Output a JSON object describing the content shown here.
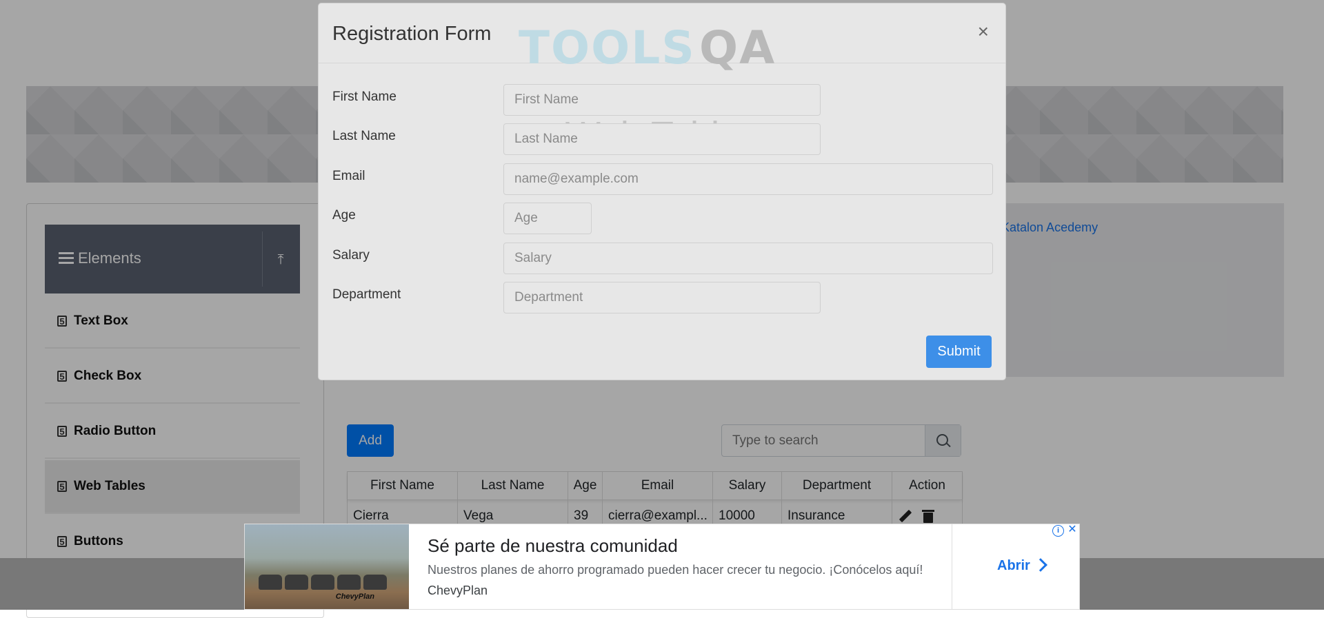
{
  "page": {
    "banner_title": "Web Tables"
  },
  "sidebar": {
    "group_title": "Elements",
    "items": [
      {
        "label": "Text Box"
      },
      {
        "label": "Check Box"
      },
      {
        "label": "Radio Button"
      },
      {
        "label": "Web Tables"
      },
      {
        "label": "Buttons"
      }
    ]
  },
  "toolbar": {
    "add_label": "Add",
    "search_placeholder": "Type to search"
  },
  "table": {
    "headers": [
      "First Name",
      "Last Name",
      "Age",
      "Email",
      "Salary",
      "Department",
      "Action"
    ],
    "rows": [
      {
        "first_name": "Cierra",
        "last_name": "Vega",
        "age": "39",
        "email": "cierra@exampl...",
        "salary": "10000",
        "department": "Insurance"
      }
    ]
  },
  "side_ad": {
    "link_text": "Katalon Acedemy"
  },
  "modal": {
    "title": "Registration Form",
    "logo_left": "TOOLS",
    "logo_right": "QA",
    "close_glyph": "×",
    "fields": [
      {
        "label": "First Name",
        "placeholder": "First Name"
      },
      {
        "label": "Last Name",
        "placeholder": "Last Name"
      },
      {
        "label": "Email",
        "placeholder": "name@example.com"
      },
      {
        "label": "Age",
        "placeholder": "Age"
      },
      {
        "label": "Salary",
        "placeholder": "Salary"
      },
      {
        "label": "Department",
        "placeholder": "Department"
      }
    ],
    "submit_label": "Submit"
  },
  "ad": {
    "title": "Sé parte de nuestra comunidad",
    "description": "Nuestros planes de ahorro programado pueden hacer crecer tu negocio. ¡Conócelos aquí!",
    "advertiser": "ChevyPlan",
    "cta_label": "Abrir",
    "image_brand": "ChevyPlan"
  },
  "colors": {
    "primary": "#007bff",
    "sidebar_header": "#5a6270",
    "submit": "#3d8fe8",
    "ad_link": "#1a73e8"
  }
}
